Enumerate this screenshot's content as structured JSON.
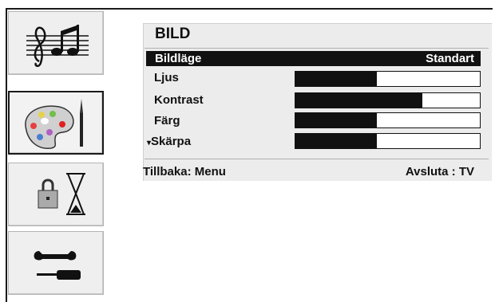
{
  "sidebar": {
    "items": [
      {
        "icon": "music-icon",
        "label": "Ljud"
      },
      {
        "icon": "palette-icon",
        "label": "Bild",
        "selected": true
      },
      {
        "icon": "lock-timer-icon",
        "label": "Funktioner"
      },
      {
        "icon": "tools-icon",
        "label": "Installation"
      }
    ]
  },
  "menu": {
    "title": "BILD",
    "selected_row": {
      "label": "Bildläge",
      "value": "Standart"
    },
    "rows": [
      {
        "label": "Ljus",
        "level": 0.44
      },
      {
        "label": "Kontrast",
        "level": 0.69
      },
      {
        "label": "Färg",
        "level": 0.44
      },
      {
        "label": "Skärpa",
        "level": 0.44,
        "arrow": "▾"
      }
    ],
    "footer": {
      "back": "Tillbaka: Menu",
      "exit": "Avsluta : TV"
    }
  },
  "colors": {
    "selected_bg": "#111111",
    "panel_bg": "#ececec",
    "bar_fill": "#111111"
  }
}
